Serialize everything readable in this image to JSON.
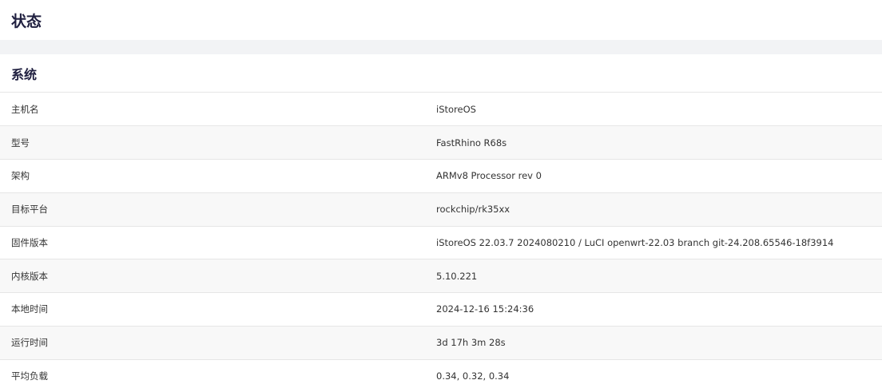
{
  "header": {
    "title": "状态"
  },
  "system": {
    "title": "系统",
    "rows": [
      {
        "label": "主机名",
        "value": "iStoreOS"
      },
      {
        "label": "型号",
        "value": "FastRhino R68s"
      },
      {
        "label": "架构",
        "value": "ARMv8 Processor rev 0"
      },
      {
        "label": "目标平台",
        "value": "rockchip/rk35xx"
      },
      {
        "label": "固件版本",
        "value": "iStoreOS 22.03.7 2024080210 / LuCI openwrt-22.03 branch git-24.208.65546-18f3914"
      },
      {
        "label": "内核版本",
        "value": "5.10.221"
      },
      {
        "label": "本地时间",
        "value": "2024-12-16 15:24:36"
      },
      {
        "label": "运行时间",
        "value": "3d 17h 3m 28s"
      },
      {
        "label": "平均负载",
        "value": "0.34, 0.32, 0.34"
      }
    ]
  }
}
